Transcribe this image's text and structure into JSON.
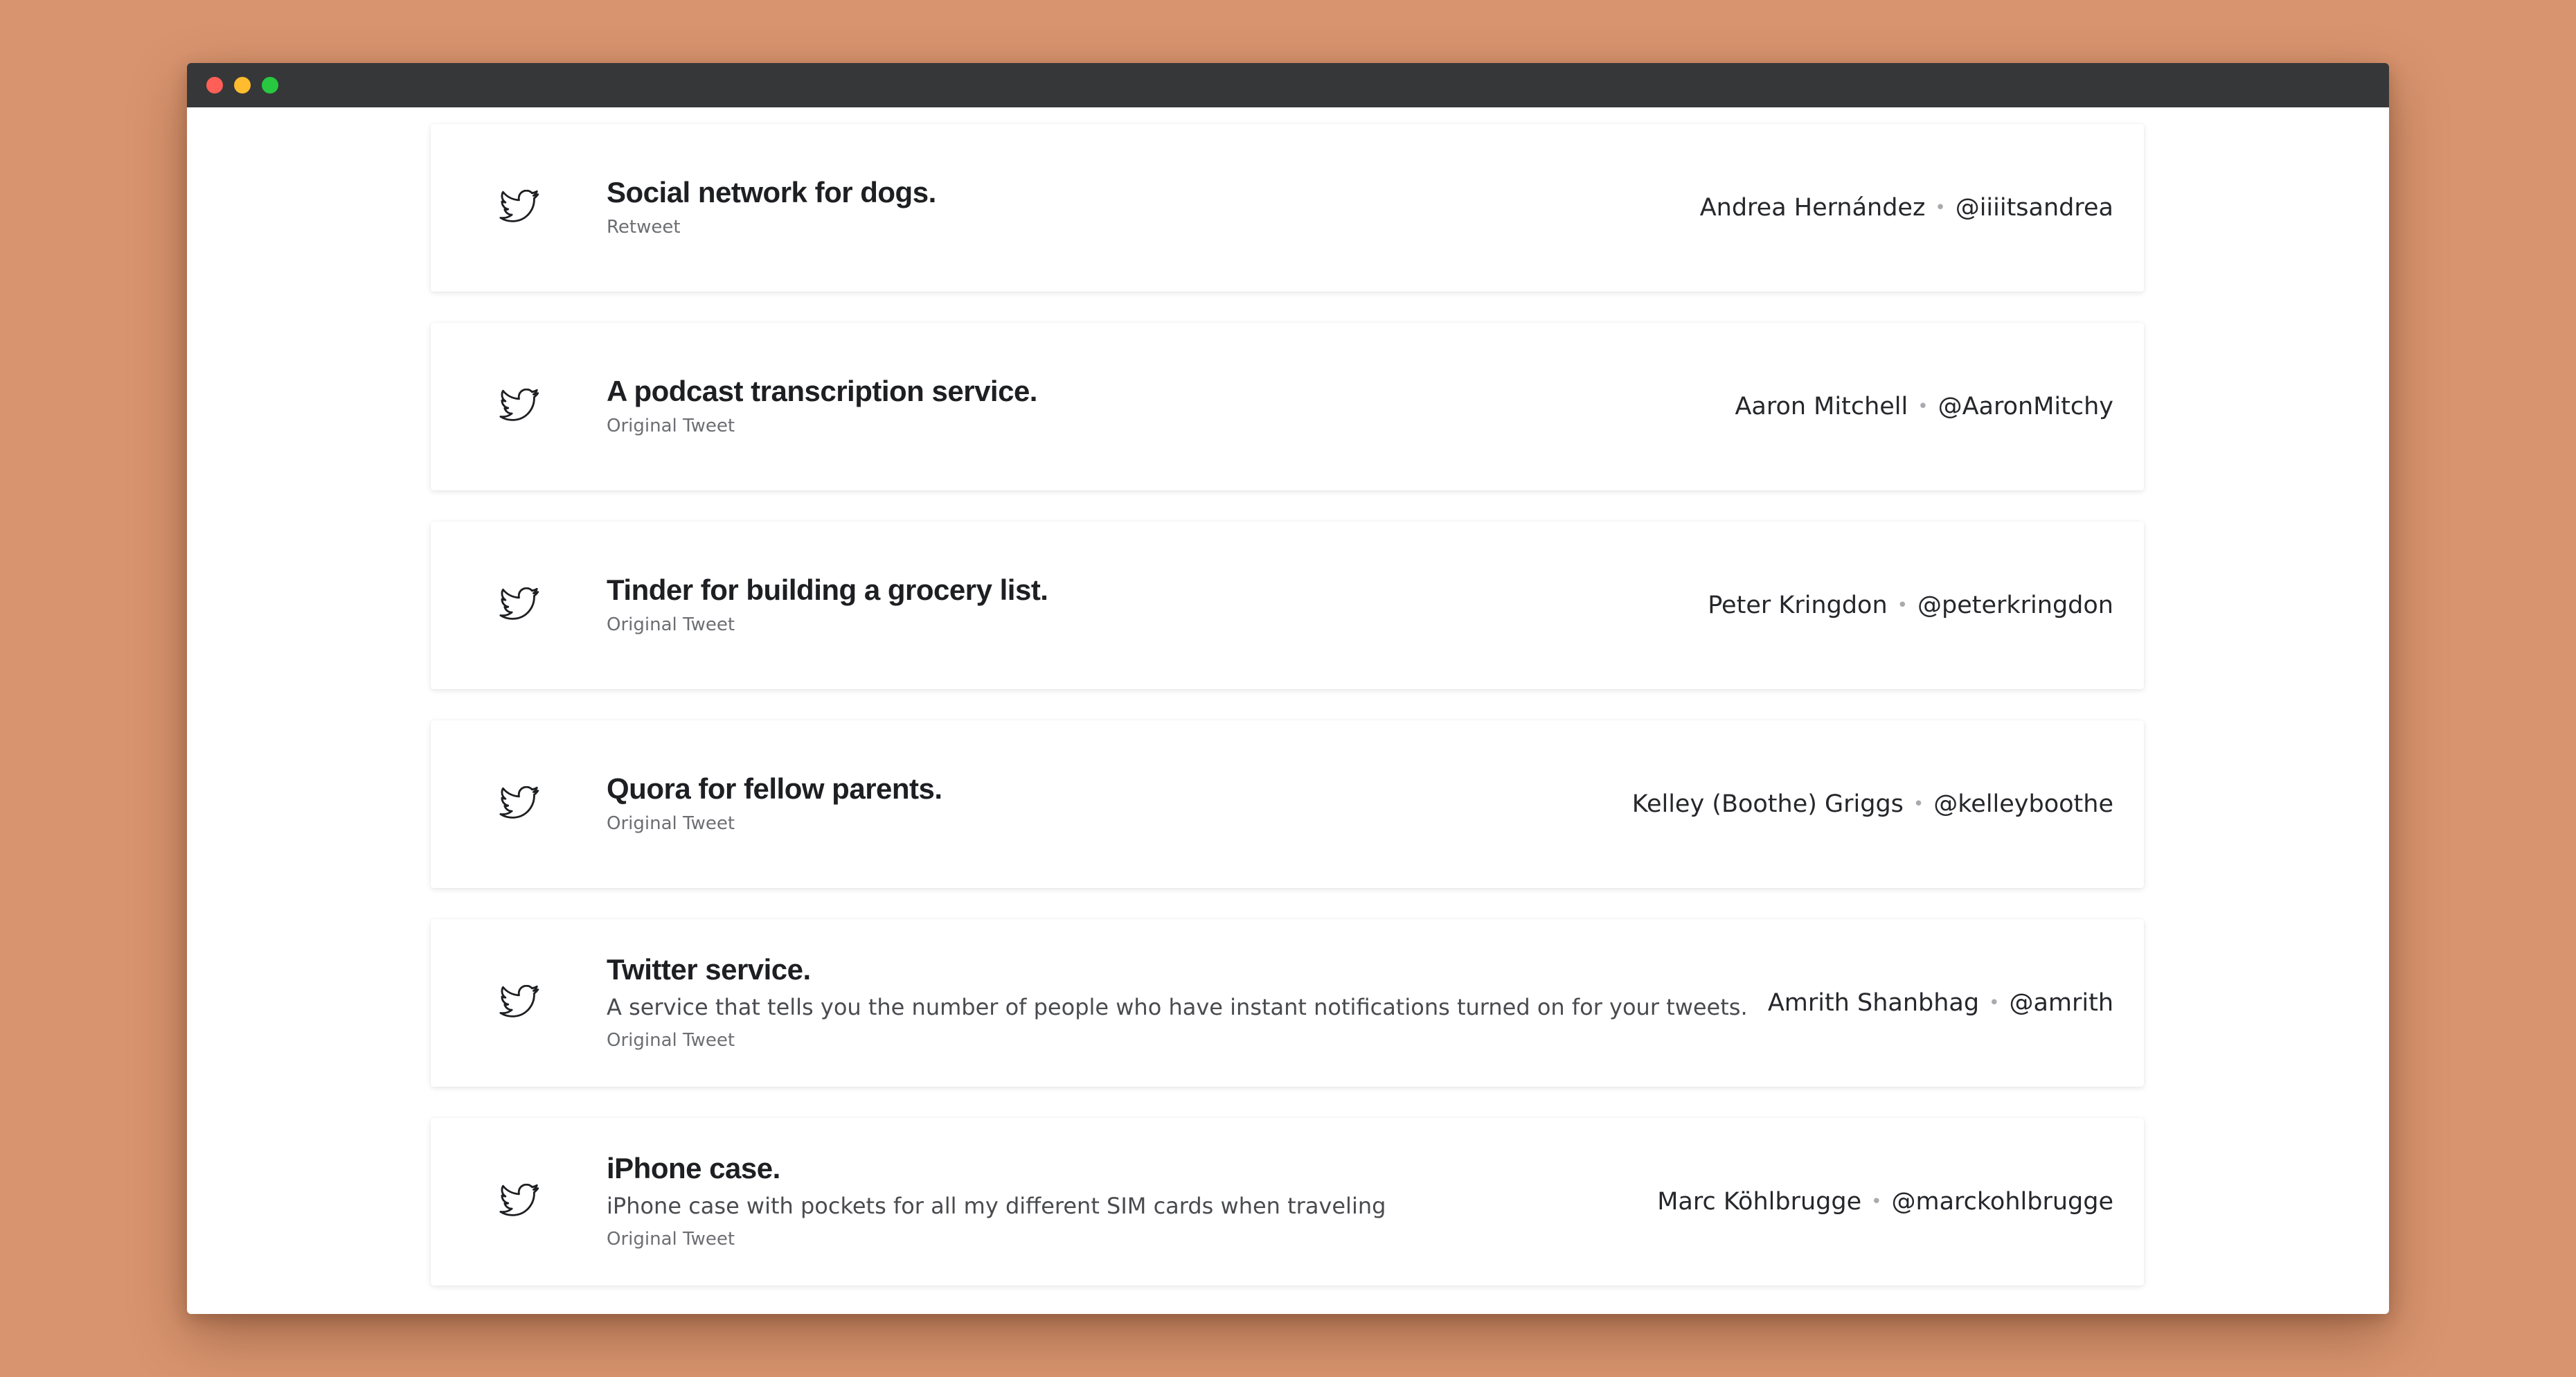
{
  "window": {
    "controls": [
      "close",
      "minimize",
      "maximize"
    ]
  },
  "ideas": [
    {
      "title": "Social network for dogs.",
      "description": "",
      "type": "Retweet",
      "author_name": "Andrea Hernández",
      "separator": "•",
      "author_handle": "@iiiitsandrea",
      "icon": "twitter-bird-icon"
    },
    {
      "title": "A podcast transcription service.",
      "description": "",
      "type": "Original Tweet",
      "author_name": "Aaron Mitchell",
      "separator": "•",
      "author_handle": "@AaronMitchy",
      "icon": "twitter-bird-icon"
    },
    {
      "title": "Tinder for building a grocery list.",
      "description": "",
      "type": "Original Tweet",
      "author_name": "Peter Kringdon",
      "separator": "•",
      "author_handle": "@peterkringdon",
      "icon": "twitter-bird-icon"
    },
    {
      "title": "Quora for fellow parents.",
      "description": "",
      "type": "Original Tweet",
      "author_name": "Kelley (Boothe) Griggs",
      "separator": "•",
      "author_handle": "@kelleyboothe",
      "icon": "twitter-bird-icon"
    },
    {
      "title": "Twitter service.",
      "description": "A service that tells you the number of people who have instant notifications turned on for your tweets.",
      "type": "Original Tweet",
      "author_name": "Amrith Shanbhag",
      "separator": "•",
      "author_handle": "@amrith",
      "icon": "twitter-bird-icon"
    },
    {
      "title": "iPhone case.",
      "description": "iPhone case with pockets for all my different SIM cards when traveling",
      "type": "Original Tweet",
      "author_name": "Marc Köhlbrugge",
      "separator": "•",
      "author_handle": "@marckohlbrugge",
      "icon": "twitter-bird-icon"
    }
  ],
  "colors": {
    "background": "#d8946e",
    "titlebar": "#363739",
    "card": "#ffffff",
    "title_text": "#1e1f22",
    "meta_text": "#6d6e72"
  }
}
